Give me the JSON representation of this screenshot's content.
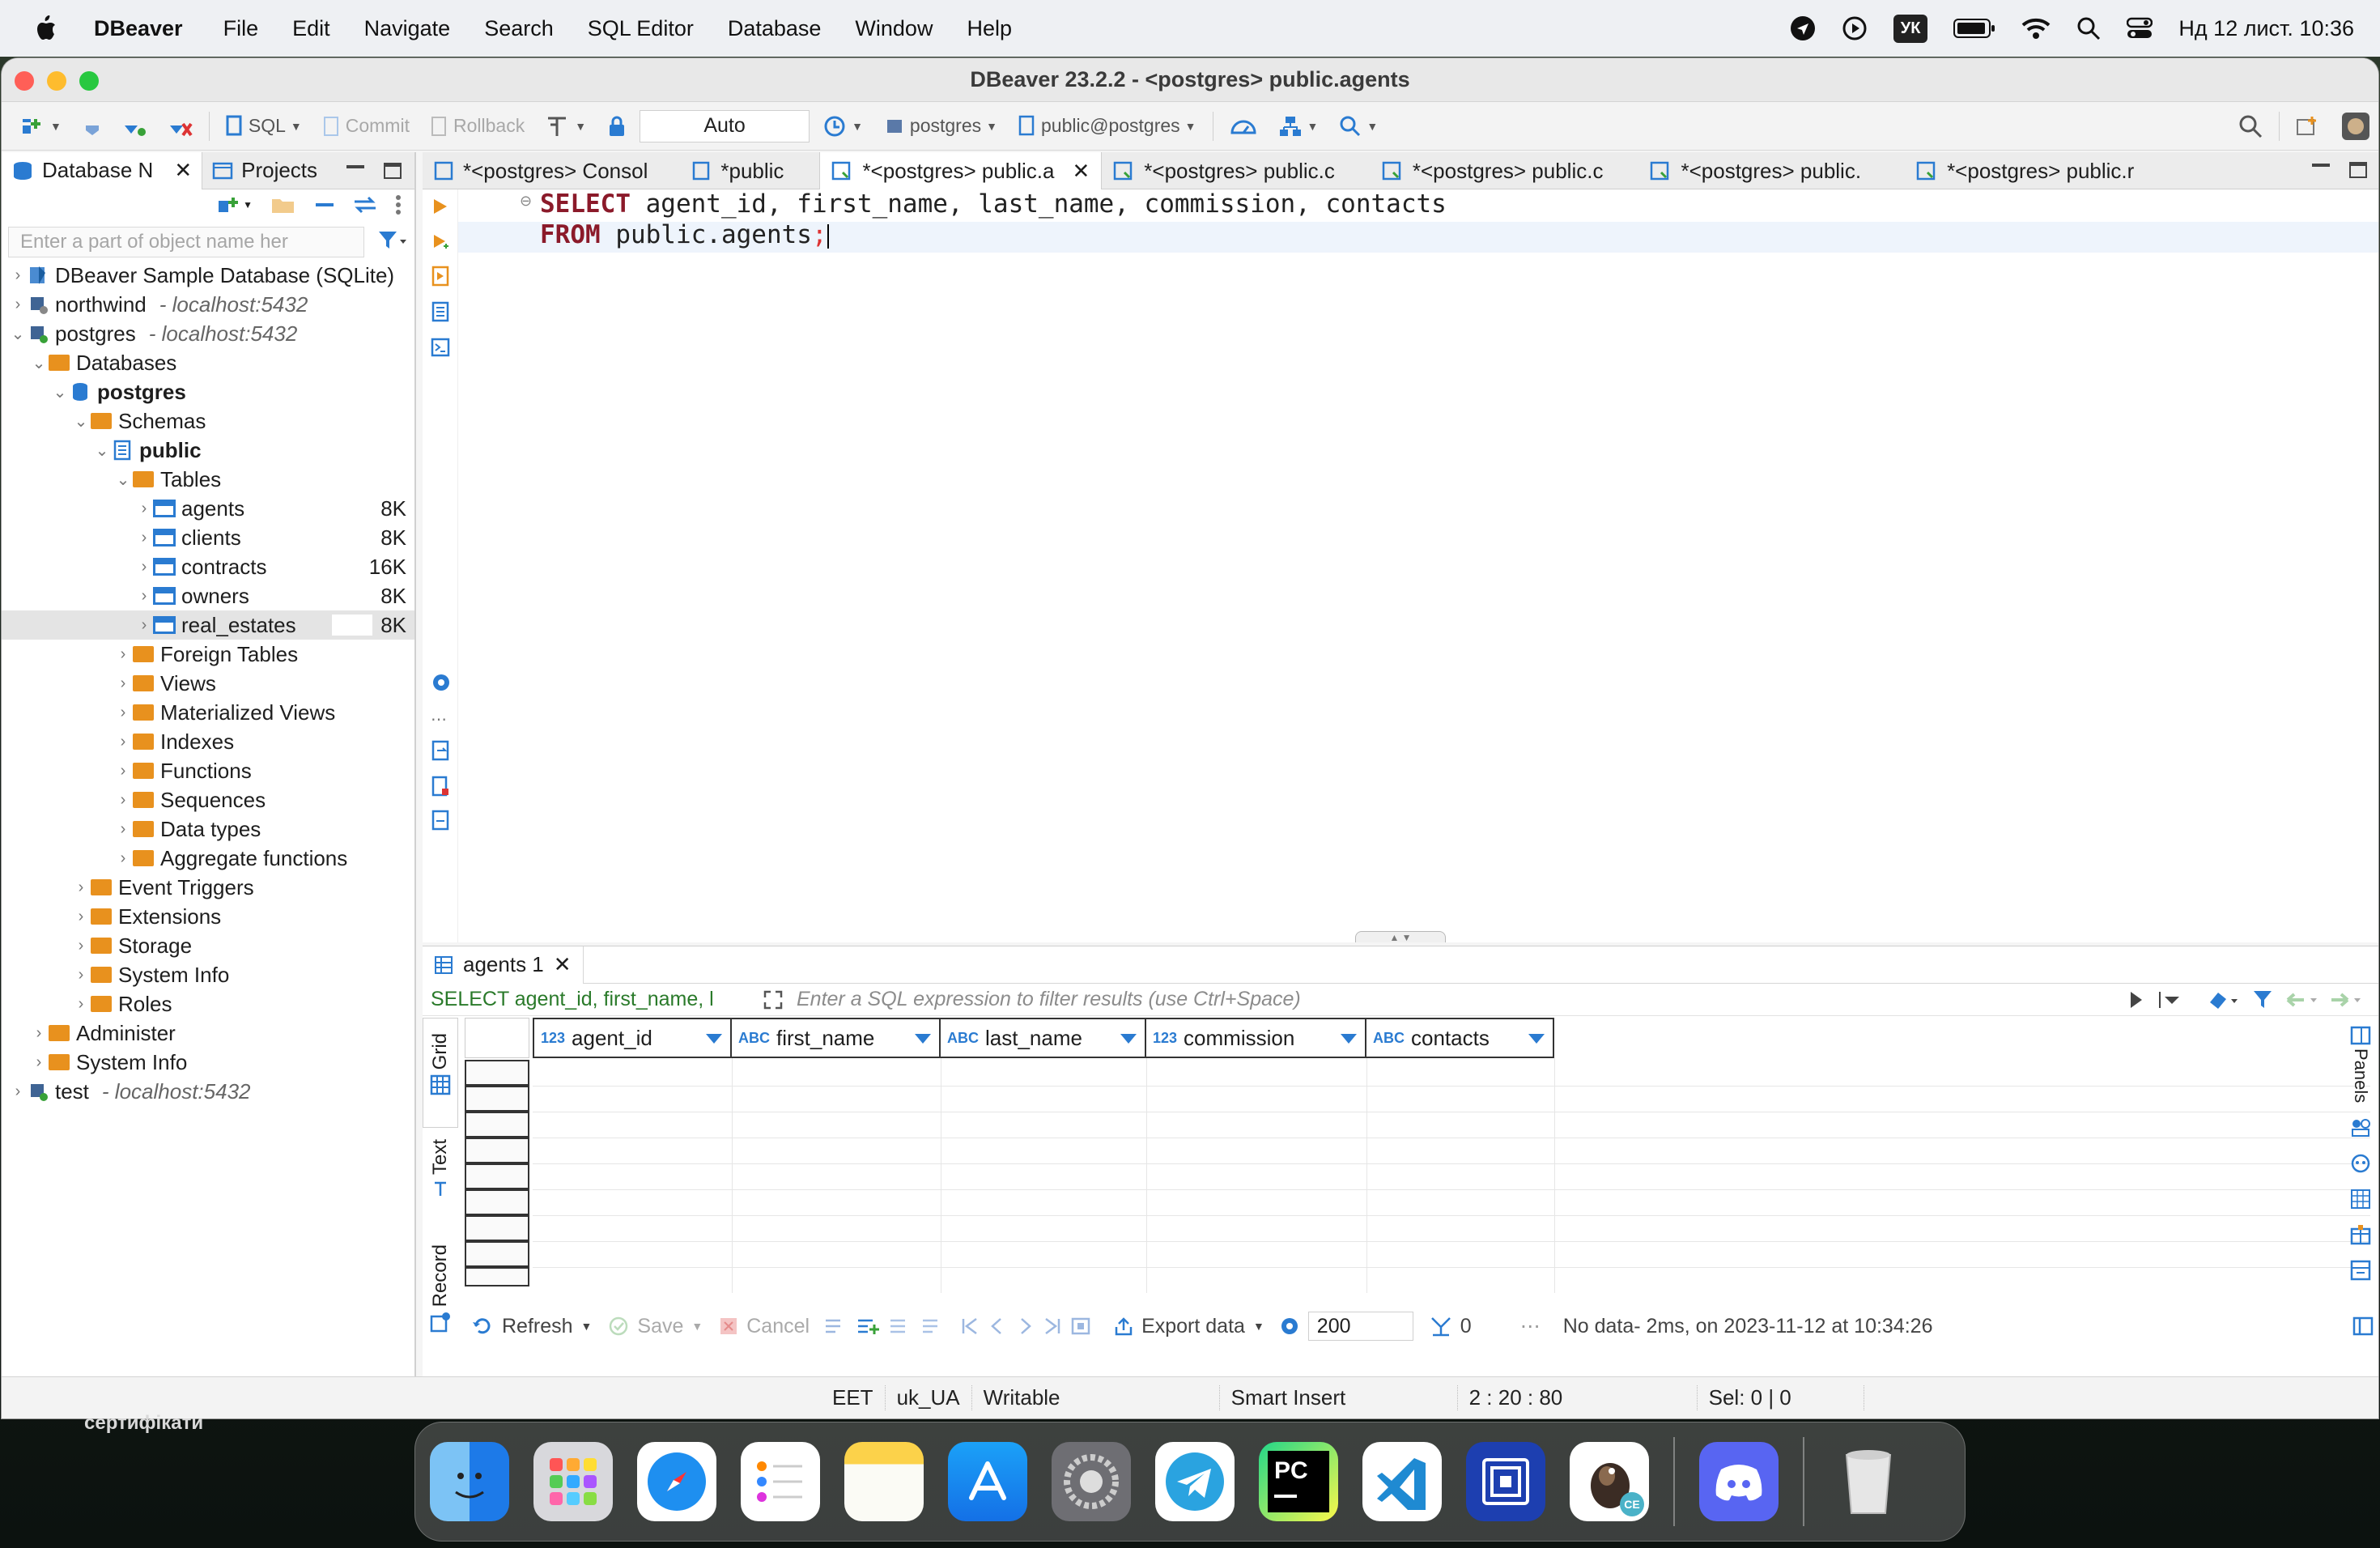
{
  "menubar": {
    "app_name": "DBeaver",
    "items": [
      "File",
      "Edit",
      "Navigate",
      "Search",
      "SQL Editor",
      "Database",
      "Window",
      "Help"
    ],
    "keyboard_layout": "УК",
    "clock": "Нд 12 лист.  10:36"
  },
  "window": {
    "title": "DBeaver 23.2.2 - <postgres> public.agents"
  },
  "toolbar": {
    "sql_label": "SQL",
    "commit_label": "Commit",
    "rollback_label": "Rollback",
    "auto_label": "Auto",
    "connection_label": "postgres",
    "schema_label": "public@postgres"
  },
  "left_pane": {
    "tab_database": "Database N",
    "tab_projects": "Projects",
    "filter_placeholder": "Enter a part of object name her",
    "tree": {
      "sample_db": "DBeaver Sample Database (SQLite)",
      "northwind": "northwind",
      "northwind_host": "- localhost:5432",
      "postgres": "postgres",
      "postgres_host": "- localhost:5432",
      "databases": "Databases",
      "postgres_db": "postgres",
      "schemas": "Schemas",
      "public": "public",
      "tables": "Tables",
      "table_items": [
        {
          "name": "agents",
          "size": "8K"
        },
        {
          "name": "clients",
          "size": "8K"
        },
        {
          "name": "contracts",
          "size": "16K"
        },
        {
          "name": "owners",
          "size": "8K"
        },
        {
          "name": "real_estates",
          "size": "8K"
        }
      ],
      "schema_folders": [
        "Foreign Tables",
        "Views",
        "Materialized Views",
        "Indexes",
        "Functions",
        "Sequences",
        "Data types",
        "Aggregate functions"
      ],
      "db_folders": [
        "Event Triggers",
        "Extensions",
        "Storage",
        "System Info",
        "Roles"
      ],
      "administer": "Administer",
      "system_info": "System Info",
      "test": "test",
      "test_host": "- localhost:5432"
    }
  },
  "editor_tabs": [
    "*<postgres> Consol",
    "*public",
    "*<postgres> public.a",
    "*<postgres> public.c",
    "*<postgres> public.c",
    "*<postgres> public.",
    "*<postgres> public.r"
  ],
  "editor": {
    "line1_kw": "SELECT",
    "line1_rest": " agent_id, first_name, last_name, commission, contacts",
    "line2_kw": "FROM",
    "line2_rest": " public.agents",
    "line2_semi": ";"
  },
  "results": {
    "tab_label": "agents 1",
    "query_preview": "SELECT agent_id, first_name, l",
    "filter_placeholder": "Enter a SQL expression to filter results (use Ctrl+Space)",
    "columns": [
      {
        "type": "123",
        "name": "agent_id"
      },
      {
        "type": "ABC",
        "name": "first_name"
      },
      {
        "type": "ABC",
        "name": "last_name"
      },
      {
        "type": "123",
        "name": "commission"
      },
      {
        "type": "ABC",
        "name": "contacts"
      }
    ],
    "vtabs": {
      "grid": "Grid",
      "text": "Text",
      "record": "Record"
    },
    "panels_label": "Panels",
    "status": {
      "refresh": "Refresh",
      "save": "Save",
      "cancel": "Cancel",
      "export": "Export data",
      "fetch_size": "200",
      "row_count": "0",
      "message": "No data- 2ms, on 2023-11-12 at 10:34:26"
    }
  },
  "bottombar": {
    "timezone": "EET",
    "locale": "uk_UA",
    "mode": "Writable",
    "insert": "Smart Insert",
    "position": "2 : 20 : 80",
    "selection": "Sel: 0 | 0"
  },
  "desktop": {
    "label": "сертифікати"
  },
  "dock": {
    "pycharm": "PC",
    "dbeaver_badge": "CE"
  }
}
